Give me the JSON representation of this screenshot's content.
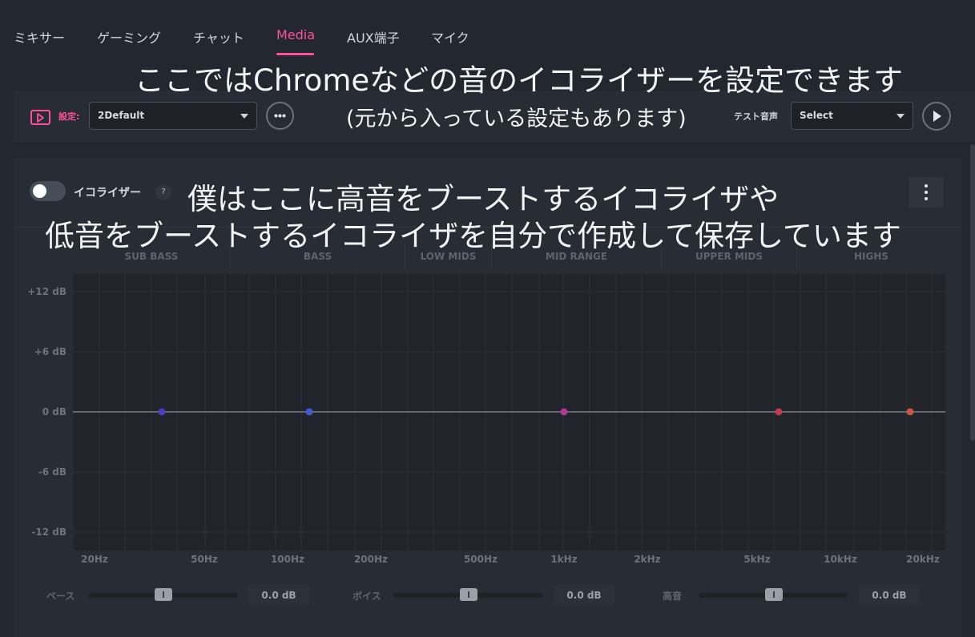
{
  "tabs": [
    {
      "label": "ミキサー",
      "active": false
    },
    {
      "label": "ゲーミング",
      "active": false
    },
    {
      "label": "チャット",
      "active": false
    },
    {
      "label": "Media",
      "active": true
    },
    {
      "label": "AUX端子",
      "active": false
    },
    {
      "label": "マイク",
      "active": false
    }
  ],
  "preset": {
    "label": "設定:",
    "value": "2Default"
  },
  "test_sound": {
    "label": "テスト音声",
    "value": "Select"
  },
  "equalizer": {
    "label": "イコライザー",
    "help": "?",
    "enabled": false,
    "bands": [
      "SUB BASS",
      "BASS",
      "LOW MIDS",
      "MID RANGE",
      "UPPER MIDS",
      "HIGHS"
    ],
    "db_ticks": [
      "+12 dB",
      "+6 dB",
      "0 dB",
      "-6 dB",
      "-12 dB"
    ],
    "hz_ticks": [
      "20Hz",
      "50Hz",
      "100Hz",
      "200Hz",
      "500Hz",
      "1kHz",
      "2kHz",
      "5kHz",
      "10kHz",
      "20kHz"
    ],
    "points": [
      {
        "gain_db": 0,
        "color": "#4a3fc4"
      },
      {
        "gain_db": 0,
        "color": "#3f5bd0"
      },
      {
        "gain_db": 0,
        "color": "#b03c8a"
      },
      {
        "gain_db": 0,
        "color": "#c0394e"
      },
      {
        "gain_db": 0,
        "color": "#c9573a"
      }
    ]
  },
  "sliders": [
    {
      "label": "ベース",
      "value": "0.0 dB"
    },
    {
      "label": "ボイス",
      "value": "0.0 dB"
    },
    {
      "label": "高音",
      "value": "0.0 dB"
    }
  ],
  "annotations": {
    "line1": "ここではChromeなどの音のイコライザーを設定できます",
    "line2": "(元から入っている設定もあります)",
    "line3": "僕はここに高音をブーストするイコライザや",
    "line4": "低音をブーストするイコライザを自分で作成して保存しています"
  },
  "colors": {
    "accent": "#ff4f9a",
    "background": "#232830",
    "panel": "#282d35"
  }
}
